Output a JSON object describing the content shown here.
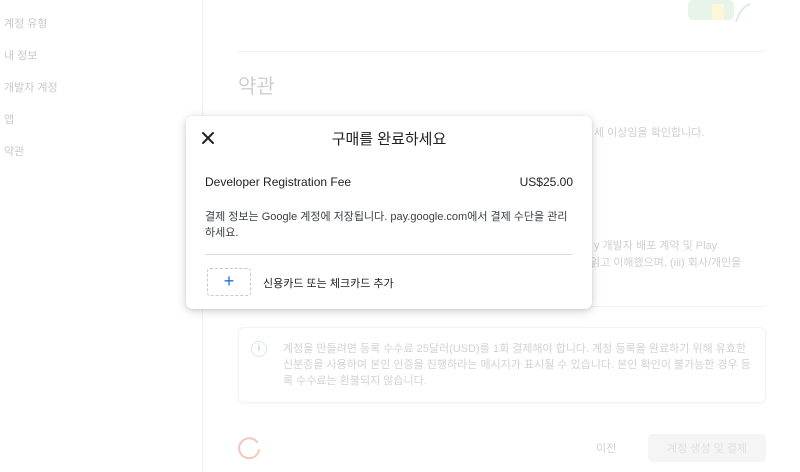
{
  "sidebar": {
    "items": [
      {
        "label": "계정 유형"
      },
      {
        "label": "내 정보"
      },
      {
        "label": "개발자 계정"
      },
      {
        "label": "앱"
      },
      {
        "label": "약관"
      }
    ]
  },
  "terms": {
    "title": "약관",
    "line_partial_1": "세 이상임을 확인합니다.",
    "line_partial_2": "y 개발자 배포 계약 및 Play",
    "line_partial_3": "읽고 이해했으며, (iii) 회사/개인을"
  },
  "info_box": {
    "icon": "info-icon",
    "text": "계정을 만들려면 등록 수수료 25달러(USD)를 1회 결제해야 합니다. 계정 등록을 완료하기 위해 유효한 신분증을 사용하여 본인 인증을 진행하라는 메시지가 표시될 수 있습니다. 본인 확인이 불가능한 경우 등록 수수료는 환불되지 않습니다."
  },
  "footer": {
    "prev_label": "이전",
    "create_label": "계정 생성 및 결제"
  },
  "dialog": {
    "title": "구매를 완료하세요",
    "close_icon": "close-icon",
    "fee_label": "Developer Registration Fee",
    "fee_amount": "US$25.00",
    "payment_note": "결제 정보는 Google 계정에 저장됩니다. pay.google.com에서 결제 수단을 관리하세요.",
    "add_card_icon": "plus-icon",
    "add_card_label": "신용카드 또는 체크카드 추가"
  },
  "colors": {
    "accent": "#1a73e8",
    "spinner": "#f4c7b8"
  }
}
